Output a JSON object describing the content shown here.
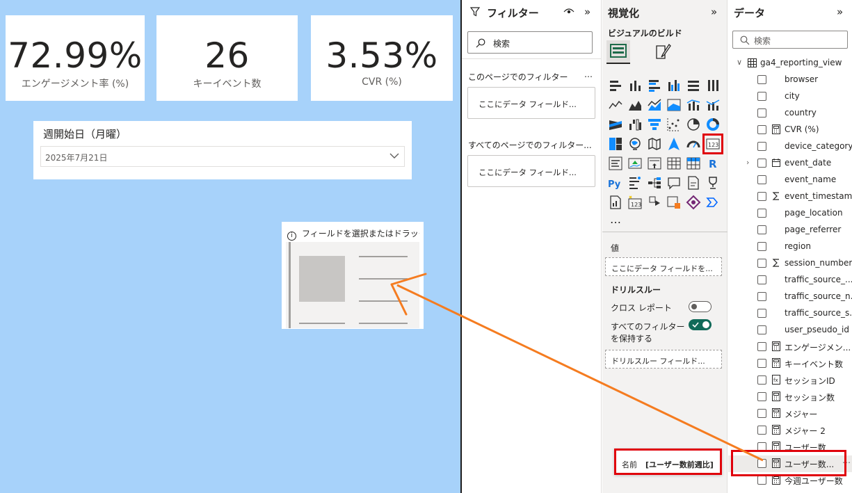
{
  "canvas": {
    "cards": [
      {
        "value": "72.99%",
        "label": "エンゲージメント率 (%)"
      },
      {
        "value": "26",
        "label": "キーイベント数"
      },
      {
        "value": "3.53%",
        "label": "CVR (%)"
      }
    ],
    "slicer": {
      "title": "週開始日（月曜）",
      "value": "2025年7月21日"
    },
    "placeholder": {
      "hint": "フィールドを選択またはドラッグしてこのビジュアルを作成"
    }
  },
  "filters_pane": {
    "title": "フィルター",
    "search_placeholder": "検索",
    "this_page_label": "このページでのフィルター",
    "this_page_more": "…",
    "this_page_drop": "ここにデータ フィールド...",
    "all_pages_label": "すべてのページでのフィルター...",
    "all_pages_drop": "ここにデータ フィールド..."
  },
  "viz_pane": {
    "title": "視覚化",
    "build_label": "ビジュアルのビルド",
    "more_label": "…",
    "values_label": "値",
    "values_drop": "ここにデータ フィールドを...",
    "drillthrough_label": "ドリルスルー",
    "cross_report_label": "クロス レポート",
    "cross_report_on": false,
    "keep_filters_label1": "すべてのフィルター",
    "keep_filters_label2": "を保持する",
    "keep_filters_on": true,
    "drill_drop": "ドリルスルー フィールド..."
  },
  "data_pane": {
    "title": "データ",
    "search_placeholder": "検索",
    "table_name": "ga4_reporting_view",
    "fields": [
      {
        "name": "browser",
        "icon": "none"
      },
      {
        "name": "city",
        "icon": "none"
      },
      {
        "name": "country",
        "icon": "none"
      },
      {
        "name": "CVR (%)",
        "icon": "calculator-icon"
      },
      {
        "name": "device_category",
        "icon": "none"
      },
      {
        "name": "event_date",
        "icon": "calendar-icon",
        "expandable": true
      },
      {
        "name": "event_name",
        "icon": "none"
      },
      {
        "name": "event_timestamp",
        "icon": "sigma-icon"
      },
      {
        "name": "page_location",
        "icon": "none"
      },
      {
        "name": "page_referrer",
        "icon": "none"
      },
      {
        "name": "region",
        "icon": "none"
      },
      {
        "name": "session_number",
        "icon": "sigma-icon"
      },
      {
        "name": "traffic_source_...",
        "icon": "none"
      },
      {
        "name": "traffic_source_n...",
        "icon": "none"
      },
      {
        "name": "traffic_source_s...",
        "icon": "none"
      },
      {
        "name": "user_pseudo_id",
        "icon": "none"
      },
      {
        "name": "エンゲージメン...",
        "icon": "calculator-icon"
      },
      {
        "name": "キーイベント数",
        "icon": "calculator-icon"
      },
      {
        "name": "セッションID",
        "icon": "calculator-fx-icon"
      },
      {
        "name": "セッション数",
        "icon": "calculator-icon"
      },
      {
        "name": "メジャー",
        "icon": "calculator-icon"
      },
      {
        "name": "メジャー 2",
        "icon": "calculator-icon"
      },
      {
        "name": "ユーザー数",
        "icon": "calculator-icon"
      },
      {
        "name": "ユーザー数...",
        "icon": "calculator-icon",
        "highlight": true,
        "more": "⋯"
      },
      {
        "name": "今週ユーザー数",
        "icon": "calculator-icon"
      }
    ]
  },
  "tooltip": {
    "key": "名前",
    "value": "[ユーザー数前週比]"
  },
  "colors": {
    "canvas_bg": "#a7d2fa",
    "accent_red": "#e0000b",
    "arrow_orange": "#f57c20",
    "toggle_on": "#116a59"
  }
}
